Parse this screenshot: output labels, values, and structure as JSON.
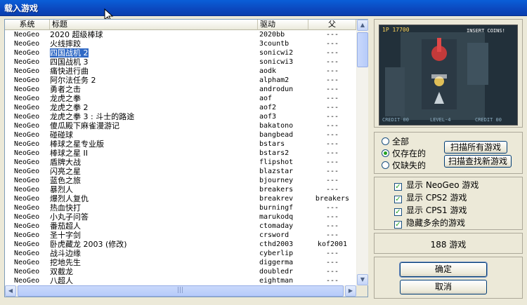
{
  "window": {
    "title": "载入游戏"
  },
  "list": {
    "headers": [
      "系统",
      "标题",
      "驱动",
      "父"
    ],
    "rows": [
      [
        "NeoGeo",
        "2020 超级棒球",
        "2020bb",
        "---"
      ],
      [
        "NeoGeo",
        "火线摔跤",
        "3countb",
        "---"
      ],
      [
        "NeoGeo",
        "四国战机 2",
        "sonicwi2",
        "---"
      ],
      [
        "NeoGeo",
        "四国战机 3",
        "sonicwi3",
        "---"
      ],
      [
        "NeoGeo",
        "痛快进行曲",
        "aodk",
        "---"
      ],
      [
        "NeoGeo",
        "阿尔法任务 2",
        "alpham2",
        "---"
      ],
      [
        "NeoGeo",
        "勇者之击",
        "androdun",
        "---"
      ],
      [
        "NeoGeo",
        "龙虎之拳",
        "aof",
        "---"
      ],
      [
        "NeoGeo",
        "龙虎之拳 2",
        "aof2",
        "---"
      ],
      [
        "NeoGeo",
        "龙虎之拳 3 : 斗士的路途",
        "aof3",
        "---"
      ],
      [
        "NeoGeo",
        "傻瓜殿下麻雀漫游记",
        "bakatono",
        "---"
      ],
      [
        "NeoGeo",
        "碰碰球",
        "bangbead",
        "---"
      ],
      [
        "NeoGeo",
        "棒球之星专业版",
        "bstars",
        "---"
      ],
      [
        "NeoGeo",
        "棒球之星 II",
        "bstars2",
        "---"
      ],
      [
        "NeoGeo",
        "盾牌大战",
        "flipshot",
        "---"
      ],
      [
        "NeoGeo",
        "闪亮之星",
        "blazstar",
        "---"
      ],
      [
        "NeoGeo",
        "蓝色之旅",
        "bjourney",
        "---"
      ],
      [
        "NeoGeo",
        "暴烈人",
        "breakers",
        "---"
      ],
      [
        "NeoGeo",
        "爆烈人复仇",
        "breakrev",
        "breakers"
      ],
      [
        "NeoGeo",
        "热血快打",
        "burningf",
        "---"
      ],
      [
        "NeoGeo",
        "小丸子问答",
        "marukodq",
        "---"
      ],
      [
        "NeoGeo",
        "番茄超人",
        "ctomaday",
        "---"
      ],
      [
        "NeoGeo",
        "圣十字剑",
        "crsword",
        "---"
      ],
      [
        "NeoGeo",
        "卧虎藏龙 2003 (修改)",
        "cthd2003",
        "kof2001"
      ],
      [
        "NeoGeo",
        "战斗边缘",
        "cyberlip",
        "---"
      ],
      [
        "NeoGeo",
        "挖地先生",
        "diggerma",
        "---"
      ],
      [
        "NeoGeo",
        "双截龙",
        "doubledr",
        "---"
      ],
      [
        "NeoGeo",
        "八超人",
        "eightman",
        "---"
      ]
    ],
    "selected_index": 2
  },
  "preview": {
    "score_left": "1P 17700",
    "banner": "INSERT COINS!",
    "footer_left": "CREDIT 00",
    "footer_mid": "LEVEL-4",
    "footer_right": "CREDIT 00"
  },
  "filter": {
    "options": [
      "全部",
      "仅存在的",
      "仅缺失的"
    ],
    "selected": "仅存在的",
    "scan_all_label": "扫描所有游戏",
    "scan_new_label": "扫描查找新游戏"
  },
  "checks": [
    {
      "label": "显示 NeoGeo 游戏",
      "checked": true
    },
    {
      "label": "显示 CPS2 游戏",
      "checked": true
    },
    {
      "label": "显示 CPS1 游戏",
      "checked": true
    },
    {
      "label": "隐藏多余的游戏",
      "checked": true
    }
  ],
  "count_text": "188 游戏",
  "buttons": {
    "ok": "确定",
    "cancel": "取消"
  },
  "colors": {
    "selection": "#316ac5",
    "titlebar": "#0b49c0"
  }
}
